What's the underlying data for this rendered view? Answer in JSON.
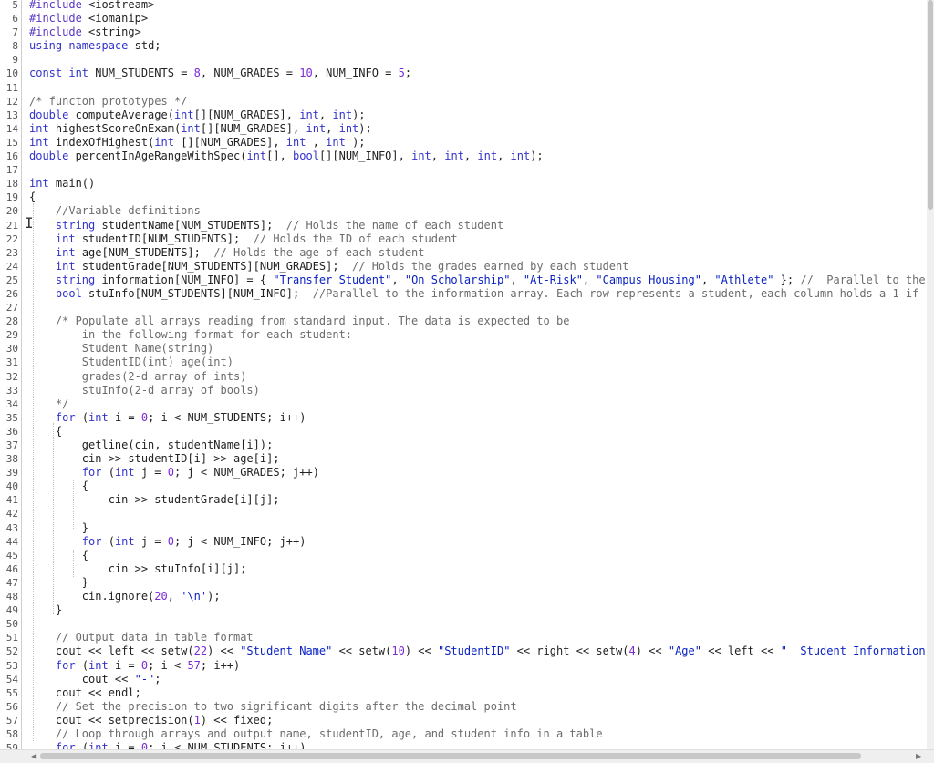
{
  "editor": {
    "first_line_number": 5,
    "active_line_number": 21,
    "lines": [
      "#include <iostream>",
      "#include <iomanip>",
      "#include <string>",
      "using namespace std;",
      "",
      "const int NUM_STUDENTS = 8, NUM_GRADES = 10, NUM_INFO = 5;",
      "",
      "/* functon prototypes */",
      "double computeAverage(int[][NUM_GRADES], int, int);",
      "int highestScoreOnExam(int[][NUM_GRADES], int, int);",
      "int indexOfHighest(int [][NUM_GRADES], int , int );",
      "double percentInAgeRangeWithSpec(int[], bool[][NUM_INFO], int, int, int, int);",
      "",
      "int main()",
      "{",
      "    //Variable definitions",
      "    string studentName[NUM_STUDENTS];  // Holds the name of each student",
      "    int studentID[NUM_STUDENTS];  // Holds the ID of each student",
      "    int age[NUM_STUDENTS];  // Holds the age of each student",
      "    int studentGrade[NUM_STUDENTS][NUM_GRADES];  // Holds the grades earned by each student",
      "    string information[NUM_INFO] = { \"Transfer Student\", \"On Scholarship\", \"At-Risk\", \"Campus Housing\", \"Athlete\" }; //  Parallel to the",
      "    bool stuInfo[NUM_STUDENTS][NUM_INFO];  //Parallel to the information array. Each row represents a student, each column holds a 1 if",
      "",
      "    /* Populate all arrays reading from standard input. The data is expected to be",
      "        in the following format for each student:",
      "        Student Name(string)",
      "        StudentID(int) age(int)",
      "        grades(2-d array of ints)",
      "        stuInfo(2-d array of bools)",
      "    */",
      "    for (int i = 0; i < NUM_STUDENTS; i++)",
      "    {",
      "        getline(cin, studentName[i]);",
      "        cin >> studentID[i] >> age[i];",
      "        for (int j = 0; j < NUM_GRADES; j++)",
      "        {",
      "            cin >> studentGrade[i][j];",
      "",
      "        }",
      "        for (int j = 0; j < NUM_INFO; j++)",
      "        {",
      "            cin >> stuInfo[i][j];",
      "        }",
      "        cin.ignore(20, '\\n');",
      "    }",
      "",
      "    // Output data in table format",
      "    cout << left << setw(22) << \"Student Name\" << setw(10) << \"StudentID\" << right << setw(4) << \"Age\" << left << \"  Student Information",
      "    for (int i = 0; i < 57; i++)",
      "        cout << \"-\";",
      "    cout << endl;",
      "    // Set the precision to two significant digits after the decimal point",
      "    cout << setprecision(1) << fixed;",
      "    // Loop through arrays and output name, studentID, age, and student info in a table",
      "    for (int i = 0; i < NUM_STUDENTS; i++)",
      ""
    ]
  },
  "icons": {
    "text_cursor": "i-beam-cursor-icon",
    "scroll_left": "arrow-left-icon",
    "scroll_right": "arrow-right-icon"
  },
  "colors": {
    "keyword": "#3333cc",
    "number": "#7a2ad6",
    "string": "#0a22c2",
    "comment": "#6c6c6c",
    "active_line": "#e9e9e9"
  }
}
